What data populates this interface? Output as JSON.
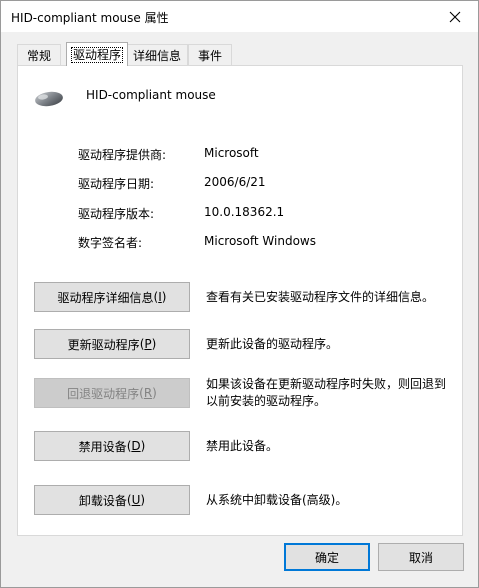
{
  "window": {
    "title": "HID-compliant mouse 属性",
    "close_glyph": "close-icon"
  },
  "tabs": [
    {
      "label": "常规",
      "active": false
    },
    {
      "label": "驱动程序",
      "active": true
    },
    {
      "label": "详细信息",
      "active": false
    },
    {
      "label": "事件",
      "active": false
    }
  ],
  "device": {
    "name": "HID-compliant mouse",
    "icon": "mouse-icon"
  },
  "driver_info": [
    {
      "label": "驱动程序提供商:",
      "value": "Microsoft"
    },
    {
      "label": "驱动程序日期:",
      "value": "2006/6/21"
    },
    {
      "label": "驱动程序版本:",
      "value": "10.0.18362.1"
    },
    {
      "label": "数字签名者:",
      "value": "Microsoft Windows"
    }
  ],
  "actions": [
    {
      "button_text": "驱动程序详细信息",
      "accel": "I",
      "enabled": true,
      "description": "查看有关已安装驱动程序文件的详细信息。"
    },
    {
      "button_text": "更新驱动程序",
      "accel": "P",
      "enabled": true,
      "description": "更新此设备的驱动程序。"
    },
    {
      "button_text": "回退驱动程序",
      "accel": "R",
      "enabled": false,
      "description": "如果该设备在更新驱动程序时失败，则回退到以前安装的驱动程序。"
    },
    {
      "button_text": "禁用设备",
      "accel": "D",
      "enabled": true,
      "description": "禁用此设备。"
    },
    {
      "button_text": "卸载设备",
      "accel": "U",
      "enabled": true,
      "description": "从系统中卸载设备(高级)。"
    }
  ],
  "footer": {
    "ok_label": "确定",
    "cancel_label": "取消"
  },
  "colors": {
    "focus_border": "#0078d7",
    "button_bg": "#e1e1e1",
    "disabled_bg": "#cccccc",
    "disabled_text": "#838383"
  }
}
